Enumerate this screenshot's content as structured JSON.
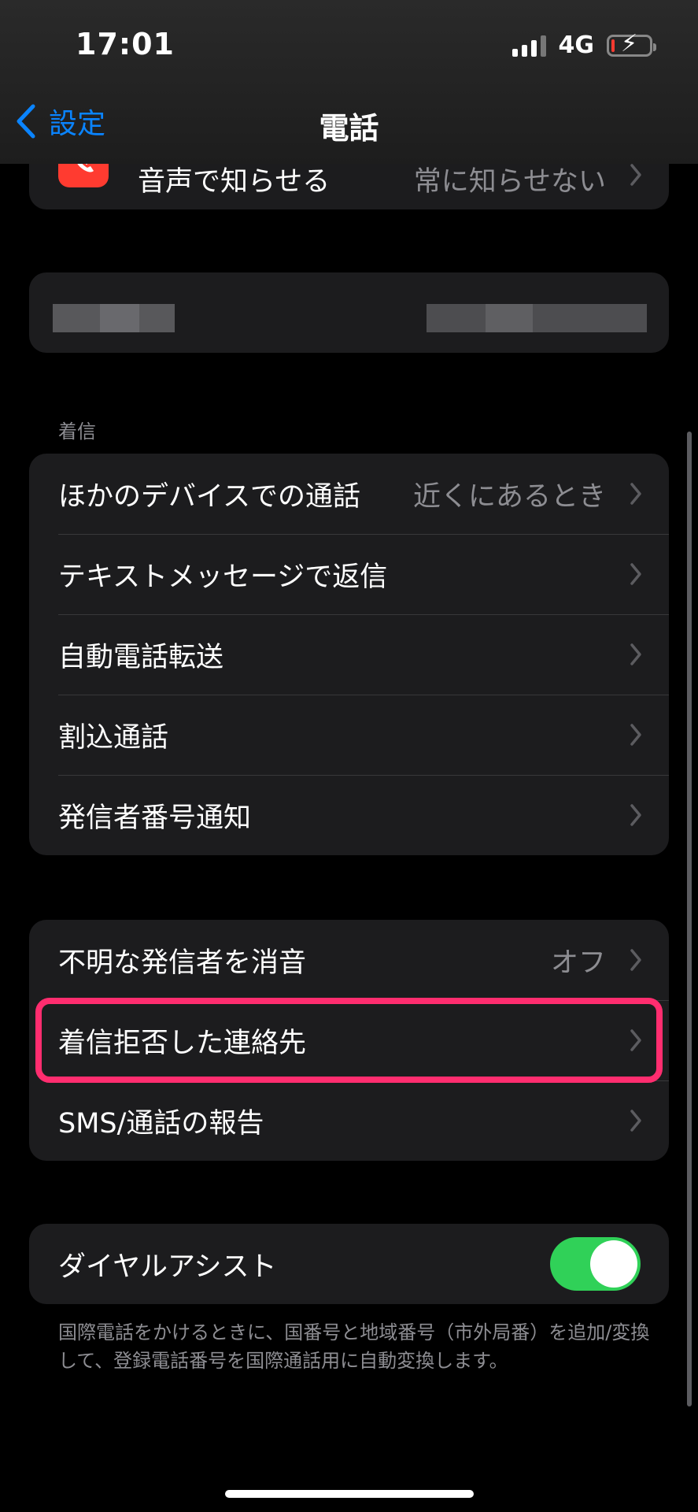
{
  "status_bar": {
    "time": "17:01",
    "network": "4G"
  },
  "nav": {
    "back_label": "設定",
    "title": "電話"
  },
  "announce_row": {
    "label": "音声で知らせる",
    "value": "常に知らせない"
  },
  "incoming": {
    "header": "着信",
    "rows": [
      {
        "label": "ほかのデバイスでの通話",
        "value": "近くにあるとき"
      },
      {
        "label": "テキストメッセージで返信",
        "value": ""
      },
      {
        "label": "自動電話転送",
        "value": ""
      },
      {
        "label": "割込通話",
        "value": ""
      },
      {
        "label": "発信者番号通知",
        "value": ""
      }
    ]
  },
  "blocking": {
    "rows": [
      {
        "label": "不明な発信者を消音",
        "value": "オフ"
      },
      {
        "label": "着信拒否した連絡先",
        "value": ""
      },
      {
        "label": "SMS/通話の報告",
        "value": ""
      }
    ]
  },
  "dial_assist": {
    "label": "ダイヤルアシスト",
    "enabled": true,
    "note": "国際電話をかけるときに、国番号と地域番号（市外局番）を追加/変換して、登録電話番号を国際通話用に自動変換します。"
  },
  "colors": {
    "accent": "#0a84ff",
    "toggle_on": "#30d158",
    "highlight": "#ff2d6f",
    "phone_icon_bg": "#ff3b30"
  },
  "icons": [
    "chevron-left-icon",
    "chevron-right-icon",
    "phone-waveform-icon",
    "signal-icon",
    "battery-charging-icon"
  ]
}
